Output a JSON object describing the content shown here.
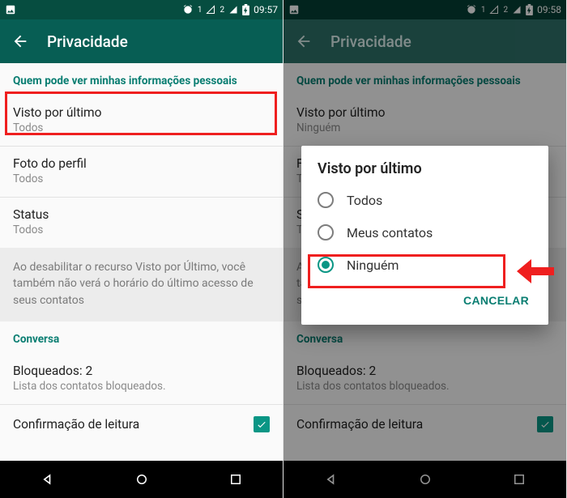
{
  "statusbar": {
    "time_left": "09:57",
    "time_right": "09:58",
    "sim1": "1",
    "sim2": "2"
  },
  "appbar": {
    "title": "Privacidade"
  },
  "sections": {
    "personal_header": "Quem pode ver minhas informações pessoais",
    "conversation_header": "Conversa"
  },
  "rows": {
    "last_seen": {
      "title": "Visto por último",
      "value_left": "Todos",
      "value_right": "Ninguém"
    },
    "photo": {
      "title": "Foto do perfil",
      "value": "Todos"
    },
    "status": {
      "title": "Status",
      "value": "Todos"
    },
    "info_note": "Ao desabilitar o recurso Visto por Último, você também não verá o horário do último acesso de seus contatos",
    "blocked": {
      "title": "Bloqueados: 2",
      "sub": "Lista dos contatos bloqueados."
    },
    "read_receipt": "Confirmação de leitura"
  },
  "dialog": {
    "title": "Visto por último",
    "options": {
      "everyone": "Todos",
      "contacts": "Meus contatos",
      "nobody": "Ninguém"
    },
    "cancel": "CANCELAR"
  }
}
